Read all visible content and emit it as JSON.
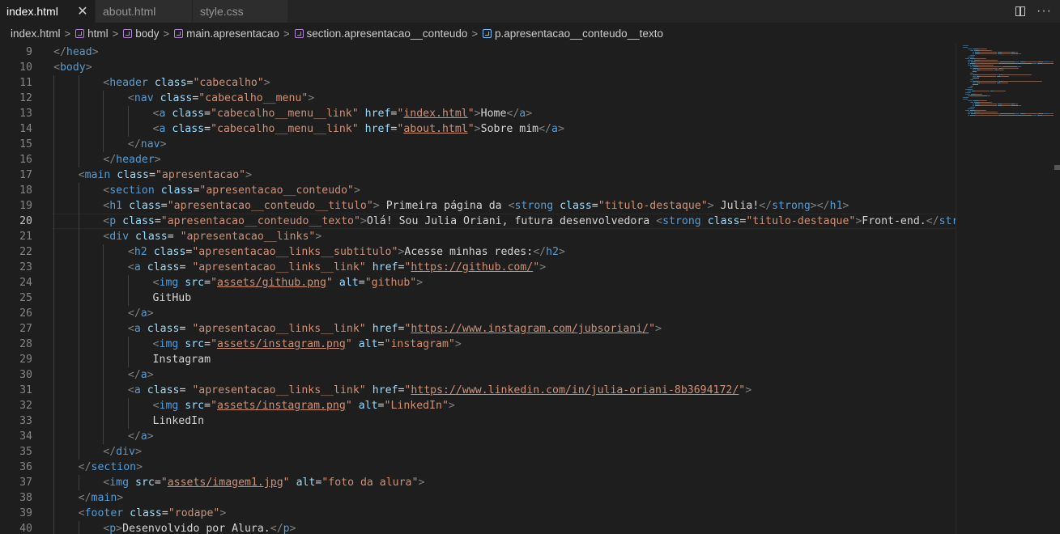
{
  "tabs": [
    {
      "label": "index.html",
      "active": true,
      "close_icon": "close-icon"
    },
    {
      "label": "about.html",
      "active": false
    },
    {
      "label": "style.css",
      "active": false
    }
  ],
  "editor_actions": {
    "split_icon": "split-editor-icon",
    "more_icon": "more-actions-icon",
    "more_label": "···"
  },
  "breadcrumb": [
    {
      "label": "index.html",
      "icon": null
    },
    {
      "label": "html",
      "icon": "element-icon"
    },
    {
      "label": "body",
      "icon": "element-icon"
    },
    {
      "label": "main.apresentacao",
      "icon": "element-icon"
    },
    {
      "label": "section.apresentacao__conteudo",
      "icon": "element-icon"
    },
    {
      "label": "p.apresentacao__conteudo__texto",
      "icon": "element-icon"
    }
  ],
  "code": {
    "current_line": 20,
    "lines": [
      {
        "n": "9",
        "indent": 0,
        "tokens": [
          [
            "p",
            "</"
          ],
          [
            "t",
            "head"
          ],
          [
            "p",
            ">"
          ]
        ]
      },
      {
        "n": "10",
        "indent": 0,
        "tokens": [
          [
            "p",
            "<"
          ],
          [
            "t",
            "body"
          ],
          [
            "p",
            ">"
          ]
        ]
      },
      {
        "n": "11",
        "indent": 2,
        "tokens": [
          [
            "p",
            "<"
          ],
          [
            "t",
            "header"
          ],
          [
            "x",
            " "
          ],
          [
            "a",
            "class"
          ],
          [
            "x",
            "="
          ],
          [
            "s",
            "\"cabecalho\""
          ],
          [
            "p",
            ">"
          ]
        ]
      },
      {
        "n": "12",
        "indent": 3,
        "tokens": [
          [
            "p",
            "<"
          ],
          [
            "t",
            "nav"
          ],
          [
            "x",
            " "
          ],
          [
            "a",
            "class"
          ],
          [
            "x",
            "="
          ],
          [
            "s",
            "\"cabecalho__menu\""
          ],
          [
            "p",
            ">"
          ]
        ]
      },
      {
        "n": "13",
        "indent": 4,
        "tokens": [
          [
            "p",
            "<"
          ],
          [
            "t",
            "a"
          ],
          [
            "x",
            " "
          ],
          [
            "a",
            "class"
          ],
          [
            "x",
            "="
          ],
          [
            "s",
            "\"cabecalho__menu__link\""
          ],
          [
            "x",
            " "
          ],
          [
            "a",
            "href"
          ],
          [
            "x",
            "="
          ],
          [
            "s",
            "\""
          ],
          [
            "l",
            "index.html"
          ],
          [
            "s",
            "\""
          ],
          [
            "p",
            ">"
          ],
          [
            "x",
            "Home"
          ],
          [
            "p",
            "</"
          ],
          [
            "t",
            "a"
          ],
          [
            "p",
            ">"
          ]
        ]
      },
      {
        "n": "14",
        "indent": 4,
        "tokens": [
          [
            "p",
            "<"
          ],
          [
            "t",
            "a"
          ],
          [
            "x",
            " "
          ],
          [
            "a",
            "class"
          ],
          [
            "x",
            "="
          ],
          [
            "s",
            "\"cabecalho__menu__link\""
          ],
          [
            "x",
            " "
          ],
          [
            "a",
            "href"
          ],
          [
            "x",
            "="
          ],
          [
            "s",
            "\""
          ],
          [
            "l",
            "about.html"
          ],
          [
            "s",
            "\""
          ],
          [
            "p",
            ">"
          ],
          [
            "x",
            "Sobre mim"
          ],
          [
            "p",
            "</"
          ],
          [
            "t",
            "a"
          ],
          [
            "p",
            ">"
          ]
        ]
      },
      {
        "n": "15",
        "indent": 3,
        "tokens": [
          [
            "p",
            "</"
          ],
          [
            "t",
            "nav"
          ],
          [
            "p",
            ">"
          ]
        ]
      },
      {
        "n": "16",
        "indent": 2,
        "tokens": [
          [
            "p",
            "</"
          ],
          [
            "t",
            "header"
          ],
          [
            "p",
            ">"
          ]
        ]
      },
      {
        "n": "17",
        "indent": 1,
        "tokens": [
          [
            "p",
            "<"
          ],
          [
            "t",
            "main"
          ],
          [
            "x",
            " "
          ],
          [
            "a",
            "class"
          ],
          [
            "x",
            "="
          ],
          [
            "s",
            "\"apresentacao\""
          ],
          [
            "p",
            ">"
          ]
        ]
      },
      {
        "n": "18",
        "indent": 2,
        "tokens": [
          [
            "p",
            "<"
          ],
          [
            "t",
            "section"
          ],
          [
            "x",
            " "
          ],
          [
            "a",
            "class"
          ],
          [
            "x",
            "="
          ],
          [
            "s",
            "\"apresentacao__conteudo\""
          ],
          [
            "p",
            ">"
          ]
        ]
      },
      {
        "n": "19",
        "indent": 2,
        "tokens": [
          [
            "p",
            "<"
          ],
          [
            "t",
            "h1"
          ],
          [
            "x",
            " "
          ],
          [
            "a",
            "class"
          ],
          [
            "x",
            "="
          ],
          [
            "s",
            "\"apresentacao__conteudo__titulo\""
          ],
          [
            "p",
            ">"
          ],
          [
            "x",
            " Primeira página da "
          ],
          [
            "p",
            "<"
          ],
          [
            "t",
            "strong"
          ],
          [
            "x",
            " "
          ],
          [
            "a",
            "class"
          ],
          [
            "x",
            "="
          ],
          [
            "s",
            "\"titulo-destaque\""
          ],
          [
            "p",
            ">"
          ],
          [
            "x",
            " Julia!"
          ],
          [
            "p",
            "</"
          ],
          [
            "t",
            "strong"
          ],
          [
            "p",
            "></"
          ],
          [
            "t",
            "h1"
          ],
          [
            "p",
            ">"
          ]
        ]
      },
      {
        "n": "20",
        "indent": 2,
        "tokens": [
          [
            "p",
            "<"
          ],
          [
            "t",
            "p"
          ],
          [
            "x",
            " "
          ],
          [
            "a",
            "class"
          ],
          [
            "x",
            "="
          ],
          [
            "s",
            "\"apresentacao__conteudo__texto\""
          ],
          [
            "p",
            ">"
          ],
          [
            "x",
            "Olá! Sou Julia Oriani, futura desenvolvedora "
          ],
          [
            "p",
            "<"
          ],
          [
            "t",
            "strong"
          ],
          [
            "x",
            " "
          ],
          [
            "a",
            "class"
          ],
          [
            "x",
            "="
          ],
          [
            "s",
            "\"titulo-destaque\""
          ],
          [
            "p",
            ">"
          ],
          [
            "x",
            "Front-end."
          ],
          [
            "p",
            "</"
          ],
          [
            "t",
            "strong"
          ],
          [
            "p",
            ">"
          ]
        ]
      },
      {
        "n": "21",
        "indent": 2,
        "tokens": [
          [
            "p",
            "<"
          ],
          [
            "t",
            "div"
          ],
          [
            "x",
            " "
          ],
          [
            "a",
            "class"
          ],
          [
            "x",
            "= "
          ],
          [
            "s",
            "\"apresentacao__links\""
          ],
          [
            "p",
            ">"
          ]
        ]
      },
      {
        "n": "22",
        "indent": 3,
        "tokens": [
          [
            "p",
            "<"
          ],
          [
            "t",
            "h2"
          ],
          [
            "x",
            " "
          ],
          [
            "a",
            "class"
          ],
          [
            "x",
            "="
          ],
          [
            "s",
            "\"apresentacao__links__subtitulo\""
          ],
          [
            "p",
            ">"
          ],
          [
            "x",
            "Acesse minhas redes:"
          ],
          [
            "p",
            "</"
          ],
          [
            "t",
            "h2"
          ],
          [
            "p",
            ">"
          ]
        ]
      },
      {
        "n": "23",
        "indent": 3,
        "tokens": [
          [
            "p",
            "<"
          ],
          [
            "t",
            "a"
          ],
          [
            "x",
            " "
          ],
          [
            "a",
            "class"
          ],
          [
            "x",
            "= "
          ],
          [
            "s",
            "\"apresentacao__links__link\""
          ],
          [
            "x",
            " "
          ],
          [
            "a",
            "href"
          ],
          [
            "x",
            "="
          ],
          [
            "s",
            "\""
          ],
          [
            "l",
            "https://github.com/"
          ],
          [
            "s",
            "\""
          ],
          [
            "p",
            ">"
          ]
        ]
      },
      {
        "n": "24",
        "indent": 4,
        "tokens": [
          [
            "p",
            "<"
          ],
          [
            "t",
            "img"
          ],
          [
            "x",
            " "
          ],
          [
            "a",
            "src"
          ],
          [
            "x",
            "="
          ],
          [
            "s",
            "\""
          ],
          [
            "l",
            "assets/github.png"
          ],
          [
            "s",
            "\""
          ],
          [
            "x",
            " "
          ],
          [
            "a",
            "alt"
          ],
          [
            "x",
            "="
          ],
          [
            "s",
            "\"github\""
          ],
          [
            "p",
            ">"
          ]
        ]
      },
      {
        "n": "25",
        "indent": 4,
        "tokens": [
          [
            "x",
            "GitHub"
          ]
        ]
      },
      {
        "n": "26",
        "indent": 3,
        "tokens": [
          [
            "p",
            "</"
          ],
          [
            "t",
            "a"
          ],
          [
            "p",
            ">"
          ]
        ]
      },
      {
        "n": "27",
        "indent": 3,
        "tokens": [
          [
            "p",
            "<"
          ],
          [
            "t",
            "a"
          ],
          [
            "x",
            " "
          ],
          [
            "a",
            "class"
          ],
          [
            "x",
            "= "
          ],
          [
            "s",
            "\"apresentacao__links__link\""
          ],
          [
            "x",
            " "
          ],
          [
            "a",
            "href"
          ],
          [
            "x",
            "="
          ],
          [
            "s",
            "\""
          ],
          [
            "l",
            "https://www.instagram.com/jubsoriani/"
          ],
          [
            "s",
            "\""
          ],
          [
            "p",
            ">"
          ]
        ]
      },
      {
        "n": "28",
        "indent": 4,
        "tokens": [
          [
            "p",
            "<"
          ],
          [
            "t",
            "img"
          ],
          [
            "x",
            " "
          ],
          [
            "a",
            "src"
          ],
          [
            "x",
            "="
          ],
          [
            "s",
            "\""
          ],
          [
            "l",
            "assets/instagram.png"
          ],
          [
            "s",
            "\""
          ],
          [
            "x",
            " "
          ],
          [
            "a",
            "alt"
          ],
          [
            "x",
            "="
          ],
          [
            "s",
            "\"instagram\""
          ],
          [
            "p",
            ">"
          ]
        ]
      },
      {
        "n": "29",
        "indent": 4,
        "tokens": [
          [
            "x",
            "Instagram"
          ]
        ]
      },
      {
        "n": "30",
        "indent": 3,
        "tokens": [
          [
            "p",
            "</"
          ],
          [
            "t",
            "a"
          ],
          [
            "p",
            ">"
          ]
        ]
      },
      {
        "n": "31",
        "indent": 3,
        "tokens": [
          [
            "p",
            "<"
          ],
          [
            "t",
            "a"
          ],
          [
            "x",
            " "
          ],
          [
            "a",
            "class"
          ],
          [
            "x",
            "= "
          ],
          [
            "s",
            "\"apresentacao__links__link\""
          ],
          [
            "x",
            " "
          ],
          [
            "a",
            "href"
          ],
          [
            "x",
            "="
          ],
          [
            "s",
            "\""
          ],
          [
            "l",
            "https://www.linkedin.com/in/julia-oriani-8b3694172/"
          ],
          [
            "s",
            "\""
          ],
          [
            "p",
            ">"
          ]
        ]
      },
      {
        "n": "32",
        "indent": 4,
        "tokens": [
          [
            "p",
            "<"
          ],
          [
            "t",
            "img"
          ],
          [
            "x",
            " "
          ],
          [
            "a",
            "src"
          ],
          [
            "x",
            "="
          ],
          [
            "s",
            "\""
          ],
          [
            "l",
            "assets/instagram.png"
          ],
          [
            "s",
            "\""
          ],
          [
            "x",
            " "
          ],
          [
            "a",
            "alt"
          ],
          [
            "x",
            "="
          ],
          [
            "s",
            "\"LinkedIn\""
          ],
          [
            "p",
            ">"
          ]
        ]
      },
      {
        "n": "33",
        "indent": 4,
        "tokens": [
          [
            "x",
            "LinkedIn"
          ]
        ]
      },
      {
        "n": "34",
        "indent": 3,
        "tokens": [
          [
            "p",
            "</"
          ],
          [
            "t",
            "a"
          ],
          [
            "p",
            ">"
          ]
        ]
      },
      {
        "n": "35",
        "indent": 2,
        "tokens": [
          [
            "p",
            "</"
          ],
          [
            "t",
            "div"
          ],
          [
            "p",
            ">"
          ]
        ]
      },
      {
        "n": "36",
        "indent": 1,
        "tokens": [
          [
            "p",
            "</"
          ],
          [
            "t",
            "section"
          ],
          [
            "p",
            ">"
          ]
        ]
      },
      {
        "n": "37",
        "indent": 2,
        "tokens": [
          [
            "p",
            "<"
          ],
          [
            "t",
            "img"
          ],
          [
            "x",
            " "
          ],
          [
            "a",
            "src"
          ],
          [
            "x",
            "="
          ],
          [
            "s",
            "\""
          ],
          [
            "l",
            "assets/imagem1.jpg"
          ],
          [
            "s",
            "\""
          ],
          [
            "x",
            " "
          ],
          [
            "a",
            "alt"
          ],
          [
            "x",
            "="
          ],
          [
            "s",
            "\"foto da alura\""
          ],
          [
            "p",
            ">"
          ]
        ]
      },
      {
        "n": "38",
        "indent": 1,
        "tokens": [
          [
            "p",
            "</"
          ],
          [
            "t",
            "main"
          ],
          [
            "p",
            ">"
          ]
        ]
      },
      {
        "n": "39",
        "indent": 1,
        "tokens": [
          [
            "p",
            "<"
          ],
          [
            "t",
            "footer"
          ],
          [
            "x",
            " "
          ],
          [
            "a",
            "class"
          ],
          [
            "x",
            "="
          ],
          [
            "s",
            "\"rodape\""
          ],
          [
            "p",
            ">"
          ]
        ]
      },
      {
        "n": "40",
        "indent": 2,
        "tokens": [
          [
            "p",
            "<"
          ],
          [
            "t",
            "p"
          ],
          [
            "p",
            ">"
          ],
          [
            "x",
            "Desenvolvido por Alura."
          ],
          [
            "p",
            "</"
          ],
          [
            "t",
            "p"
          ],
          [
            "p",
            ">"
          ]
        ]
      }
    ]
  },
  "colors": {
    "background": "#1e1e1e",
    "tag": "#569cd6",
    "attribute": "#9cdcfe",
    "string": "#ce9178",
    "punctuation": "#808080",
    "text": "#d4d4d4",
    "line_number": "#858585"
  }
}
